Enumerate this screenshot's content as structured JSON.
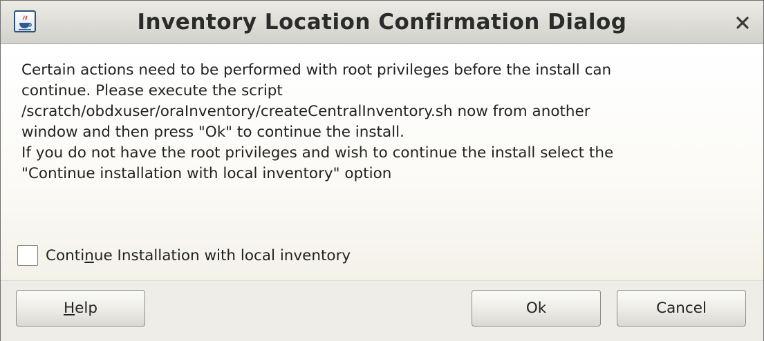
{
  "window": {
    "title": "Inventory Location Confirmation Dialog",
    "app_icon": "java-icon",
    "close_icon": "close-icon"
  },
  "message": {
    "lines": [
      "Certain actions need to be performed with root privileges before the install can",
      "continue. Please execute the script",
      "/scratch/obdxuser/oraInventory/createCentralInventory.sh now from another",
      "window and then press \"Ok\" to continue the install.",
      "If you do not have the root privileges and wish to continue the install select the",
      "\"Continue installation with local inventory\" option"
    ]
  },
  "checkbox": {
    "label_before": "Conti",
    "label_mnemonic": "n",
    "label_after": "ue Installation with local inventory",
    "checked": false
  },
  "buttons": {
    "help": {
      "mnemonic": "H",
      "rest": "elp"
    },
    "ok": "Ok",
    "cancel": "Cancel"
  },
  "colors": {
    "titlebar": "#dddcd6",
    "body": "#fbfaf6",
    "footer": "#eeede8",
    "text": "#222222"
  }
}
